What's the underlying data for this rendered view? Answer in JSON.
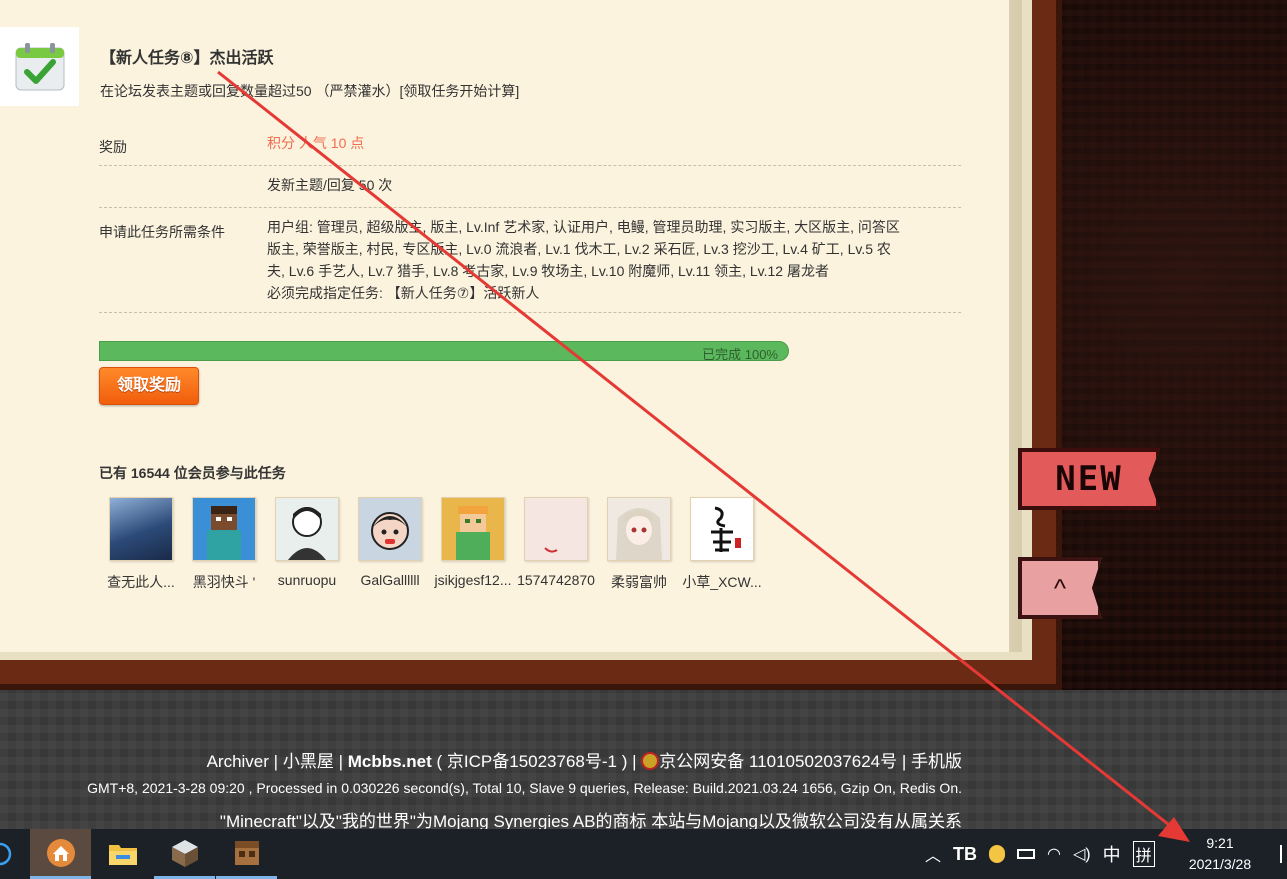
{
  "task": {
    "title": "【新人任务⑧】杰出活跃",
    "description": "在论坛发表主题或回复数量超过50 （严禁灌水）[领取任务开始计算]",
    "reward_label": "奖励",
    "reward_value": "积分 人气 10 点",
    "requirement_value": "发新主题/回复 50 次",
    "conditions_label": "申请此任务所需条件",
    "conditions_line1": "用户组: 管理员, 超级版主, 版主, Lv.Inf 艺术家, 认证用户, 电鳗, 管理员助理, 实习版主, 大区版主, 问答区",
    "conditions_line2": "版主, 荣誉版主, 村民, 专区版主, Lv.0 流浪者, Lv.1 伐木工, Lv.2 采石匠, Lv.3 挖沙工, Lv.4 矿工, Lv.5 农",
    "conditions_line3": "夫, Lv.6 手艺人, Lv.7 猎手, Lv.8 考古家, Lv.9 牧场主, Lv.10 附魔师, Lv.11 领主, Lv.12 屠龙者",
    "conditions_line4": "必须完成指定任务: 【新人任务⑦】活跃新人",
    "progress_text": "已完成 100%",
    "progress_percent": 100,
    "claim_button": "领取奖励",
    "participants_text": "已有 16544 位会员参与此任务"
  },
  "members": [
    {
      "name": "查无此人...",
      "avatar_color": "#3b5a8a"
    },
    {
      "name": "黑羽快斗 '",
      "avatar_color": "#3a8fd6"
    },
    {
      "name": "sunruopu",
      "avatar_color": "#dfe8e4"
    },
    {
      "name": "GalGallllll",
      "avatar_color": "#c9d6e2"
    },
    {
      "name": "jsikjgesf12...",
      "avatar_color": "#e8b64a"
    },
    {
      "name": "1574742870",
      "avatar_color": "#f6e6e1"
    },
    {
      "name": "柔弱富帅",
      "avatar_color": "#e9e4de"
    },
    {
      "name": "小草_XCW...",
      "avatar_color": "#ffffff"
    }
  ],
  "side_buttons": {
    "new": "NEW",
    "top": "^"
  },
  "footer": {
    "archiver": "Archiver",
    "sep1": "|",
    "xiaoheiwu": "小黑屋",
    "sep2": "|",
    "site": "Mcbbs.net",
    "icp": "( 京ICP备15023768号-1 )",
    "sep3": "|",
    "police": "京公网安备 11010502037624号",
    "sep4": "|",
    "mobile": "手机版",
    "stats": "GMT+8, 2021-3-28 09:20 , Processed in 0.030226 second(s), Total 10, Slave 9 queries, Release: Build.2021.03.24 1656, Gzip On, Redis On.",
    "notice": "\"Minecraft\"以及\"我的世界\"为Mojang Synergies AB的商标 本站与Mojang以及微软公司没有从属关系"
  },
  "taskbar": {
    "tray_ime_1": "中",
    "tray_ime_2": "拼",
    "time": "9:21",
    "date": "2021/3/28"
  },
  "colors": {
    "reward": "#f26c4f",
    "progress": "#5cb85c",
    "button": "#f25d0c",
    "arrow": "#e53935"
  }
}
